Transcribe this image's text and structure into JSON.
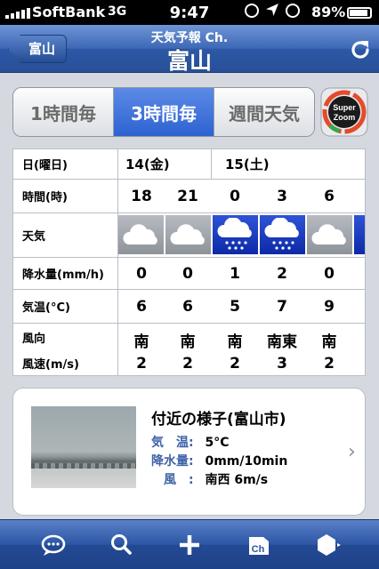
{
  "status": {
    "carrier": "SoftBank",
    "network": "3G",
    "time": "9:47",
    "battery_pct": "89%"
  },
  "nav": {
    "back_label": "富山",
    "subtitle": "天気予報 Ch.",
    "title": "富山"
  },
  "tabs": [
    {
      "label": "1時間毎",
      "active": false
    },
    {
      "label": "3時間毎",
      "active": true
    },
    {
      "label": "週間天気",
      "active": false
    }
  ],
  "superzoom": {
    "line1": "Super",
    "line2": "Zoom"
  },
  "table": {
    "headers": {
      "day": "日(曜日)",
      "hour": "時間(時)",
      "weather": "天気",
      "precip": "降水量(mm/h)",
      "temp": "気温(°C)",
      "wind_dir": "風向",
      "wind_speed": "風速(m/s)"
    },
    "days": [
      {
        "label": "14(金)"
      },
      {
        "label": "15(土)"
      }
    ],
    "columns": [
      {
        "hour": "18",
        "weather": "cloudy",
        "precip": "0",
        "temp": "6",
        "wind_dir": "南",
        "wind_speed": "2"
      },
      {
        "hour": "21",
        "weather": "cloudy",
        "precip": "0",
        "temp": "6",
        "wind_dir": "南",
        "wind_speed": "2"
      },
      {
        "hour": "0",
        "weather": "rain",
        "precip": "1",
        "temp": "5",
        "wind_dir": "南",
        "wind_speed": "2"
      },
      {
        "hour": "3",
        "weather": "rain",
        "precip": "2",
        "temp": "7",
        "wind_dir": "南東",
        "wind_speed": "3"
      },
      {
        "hour": "6",
        "weather": "cloudy",
        "precip": "0",
        "temp": "9",
        "wind_dir": "南",
        "wind_speed": "2"
      }
    ]
  },
  "nearby": {
    "title": "付近の様子(富山市)",
    "rows": [
      {
        "key": "気　温:",
        "value": "5°C"
      },
      {
        "key": "降水量:",
        "value": "0mm/10min"
      },
      {
        "key": "　風　:",
        "value": "南西 6m/s"
      }
    ]
  },
  "toolbar": {
    "ch_label": "Ch"
  },
  "colors": {
    "nav_blue": "#2d58a6",
    "tab_active": "#2d62d1",
    "rain_blue": "#0d2aa6",
    "label_blue": "#3f63a8"
  }
}
